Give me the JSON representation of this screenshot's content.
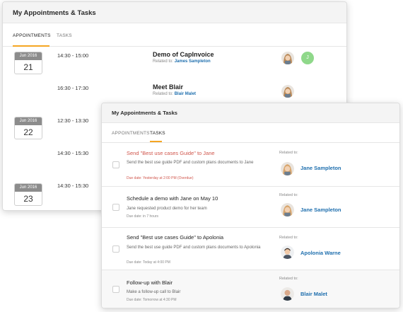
{
  "back_card": {
    "title": "My Appointments & Tasks",
    "tabs": [
      "APPOINTMENTS",
      "TASKS"
    ],
    "active_tab": "APPOINTMENTS",
    "dates": [
      {
        "month": "Jun 2016",
        "day": "21"
      },
      {
        "month": "Jun 2016",
        "day": "22"
      },
      {
        "month": "Jun 2016",
        "day": "23"
      }
    ],
    "appointments": [
      {
        "time": "14:30 - 15:00",
        "title": "Demo of CapInvoice",
        "related_prefix": "Related to:",
        "related_name": "James Sampleton",
        "extra_avatar_letter": "J"
      },
      {
        "time": "16:30 - 17:30",
        "title": "Meet Blair",
        "related_prefix": "Related to:",
        "related_name": "Blair Malet"
      },
      {
        "time": "12:30 - 13:30"
      },
      {
        "time": "14:30 - 15:30"
      },
      {
        "time": "14:30 - 15:30"
      }
    ]
  },
  "front_card": {
    "title": "My Appointments & Tasks",
    "tabs": [
      "APPOINTMENTS",
      "TASKS"
    ],
    "active_tab": "TASKS",
    "tasks": [
      {
        "title": "Send \"Best use cases Guide\" to Jane",
        "overdue": true,
        "desc": "Send the best use guide PDF and custom plans documents to Jane",
        "due": "Due date: Yesterday at 2:00 PM (Overdue)",
        "related_label": "Related to:",
        "related_name": "Jane Sampleton",
        "avatar": "woman-avatar"
      },
      {
        "title": "Schedule a demo with Jane on May 10",
        "overdue": false,
        "desc": "Jane requested product demo for her team",
        "due": "Due date: in 7 hours",
        "related_label": "Related to:",
        "related_name": "Jane Sampleton",
        "avatar": "woman-avatar"
      },
      {
        "title": "Send \"Best use cases Guide\" to Apolonia",
        "overdue": false,
        "desc": "Send the best use guide PDF and custom plans documents to Apolonia",
        "due": "Due date: Today at 4:00 PM",
        "related_label": "Related to:",
        "related_name": "Apolonia Warne",
        "avatar": "man-avatar"
      },
      {
        "title": "Follow-up with Blair",
        "overdue": false,
        "desc": "Make a follow-up call to Blair",
        "due": "Due date: Tomorrow at 4:30 PM",
        "related_label": "Related to:",
        "related_name": "Blair Malet",
        "avatar": "bald-man-avatar"
      }
    ]
  },
  "colors": {
    "accent": "#f5a623",
    "link": "#1f6fae",
    "overdue": "#d0564c",
    "badge_green": "#8fd88a"
  }
}
